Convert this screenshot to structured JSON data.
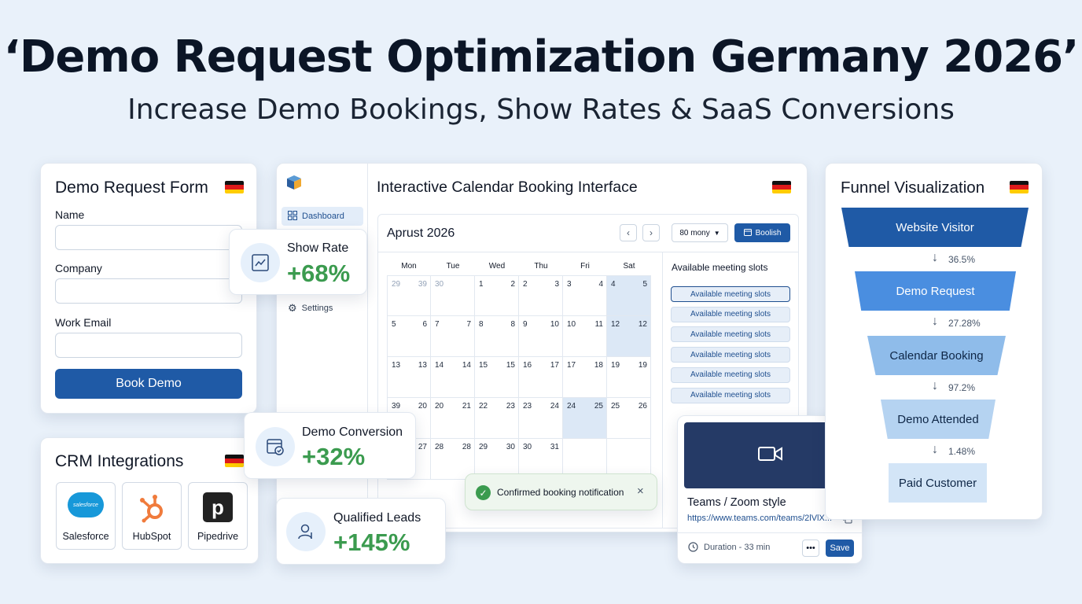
{
  "header": {
    "title": "‘Demo Request Optimization Germany 2026’",
    "subtitle": "Increase Demo Bookings, Show Rates & SaaS Conversions"
  },
  "demo_form": {
    "title": "Demo Request Form",
    "fields": [
      {
        "label": "Name",
        "value": "",
        "placeholder": ""
      },
      {
        "label": "Company",
        "value": "",
        "placeholder": ""
      },
      {
        "label": "Work Email",
        "value": "",
        "placeholder": ""
      }
    ],
    "button_label": "Book Demo"
  },
  "stats": {
    "show_rate": {
      "label": "Show Rate",
      "value": "+68%"
    },
    "demo_conversion": {
      "label": "Demo Conversion",
      "value": "+32%"
    },
    "qualified_leads": {
      "label": "Qualified Leads",
      "value": "+145%"
    }
  },
  "crm": {
    "title": "CRM Integrations",
    "items": [
      {
        "name": "Salesforce",
        "logo_text": "salesforce",
        "icon": "salesforce-logo"
      },
      {
        "name": "HubSpot",
        "icon": "hubspot-logo"
      },
      {
        "name": "Pipedrive",
        "logo_text": "p",
        "icon": "pipedrive-logo"
      }
    ]
  },
  "calendar_app": {
    "title": "Interactive Calendar Booking Interface",
    "sidebar": [
      {
        "label": "Dashboard",
        "icon": "grid-icon",
        "active": true
      },
      {
        "label": "Settings",
        "icon": "gear-icon",
        "active": false
      }
    ],
    "month_label": "Aprust 2026",
    "duration_select": "80 mony",
    "book_button": "Boolish",
    "weekdays": [
      "Mon",
      "Tue",
      "Wed",
      "Thu",
      "Fri",
      "Sat"
    ],
    "rows": [
      [
        [
          "29",
          "39"
        ],
        [
          "30",
          ""
        ],
        [
          "1",
          "2"
        ],
        [
          "2",
          "3"
        ],
        [
          "3",
          "4"
        ],
        [
          "4",
          "5"
        ]
      ],
      [
        [
          "5",
          "6"
        ],
        [
          "7",
          "7"
        ],
        [
          "8",
          "8"
        ],
        [
          "9",
          "10"
        ],
        [
          "10",
          "11"
        ],
        [
          "12",
          "12"
        ]
      ],
      [
        [
          "13",
          "13"
        ],
        [
          "14",
          "14"
        ],
        [
          "15",
          "15"
        ],
        [
          "16",
          "17"
        ],
        [
          "17",
          "18"
        ],
        [
          "19",
          "19"
        ]
      ],
      [
        [
          "39",
          "20"
        ],
        [
          "20",
          "21"
        ],
        [
          "22",
          "23"
        ],
        [
          "23",
          "24"
        ],
        [
          "24",
          "25"
        ],
        [
          "25",
          "26"
        ]
      ],
      [
        [
          "",
          "27"
        ],
        [
          "28",
          "28"
        ],
        [
          "29",
          "30"
        ],
        [
          "30",
          "31"
        ],
        [
          "",
          ""
        ],
        [
          "",
          ""
        ]
      ]
    ],
    "slots_title": "Available meeting slots",
    "slots": [
      "Available meeting slots",
      "Available meeting slots",
      "Available meeting slots",
      "Available meeting slots",
      "Available meeting slots",
      "Available meeting slots"
    ],
    "toast": "Confirmed booking notification",
    "colors": {
      "accent": "#1f5aa6",
      "highlight": "#dce8f6"
    }
  },
  "video_card": {
    "title": "Teams / Zoom style",
    "url": "https://www.teams.com/teams/2lVlX...",
    "duration": "Duration - 33 min",
    "save_label": "Save"
  },
  "funnel": {
    "title": "Funnel Visualization",
    "stages": [
      {
        "label": "Website Visitor"
      },
      {
        "label": "Demo Request"
      },
      {
        "label": "Calendar Booking"
      },
      {
        "label": "Demo Attended"
      },
      {
        "label": "Paid Customer"
      }
    ],
    "conversion_rates": [
      "36.5%",
      "27.28%",
      "97.2%",
      "1.48%"
    ]
  }
}
